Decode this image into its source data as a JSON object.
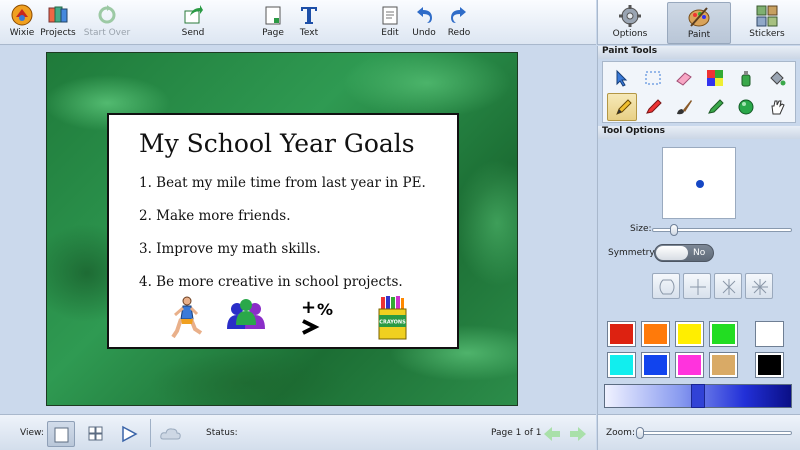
{
  "toolbar": {
    "wixie": "Wixie",
    "projects": "Projects",
    "start_over": "Start Over",
    "send": "Send",
    "page": "Page",
    "text": "Text",
    "edit": "Edit",
    "undo": "Undo",
    "redo": "Redo"
  },
  "right_tabs": {
    "options": "Options",
    "paint": "Paint",
    "stickers": "Stickers",
    "active": "Paint"
  },
  "document": {
    "title": "My School Year Goals",
    "goals": [
      "1. Beat my mile time from last year in PE.",
      "2. Make more friends.",
      "3. Improve my math skills.",
      "4. Be more creative in school projects."
    ],
    "clipart": [
      "runner-icon",
      "people-group-icon",
      "math-symbols-icon",
      "crayons-box-icon"
    ],
    "crayon_box_text": "CRAYONS"
  },
  "bottom": {
    "view_label": "View:",
    "status_label": "Status:",
    "page_indicator": "Page 1 of 1",
    "zoom_label": "Zoom:"
  },
  "panel": {
    "paint_tools_header": "Paint Tools",
    "tool_options_header": "Tool Options",
    "tools": [
      "select-arrow-icon",
      "marquee-select-icon",
      "eraser-icon",
      "color-picker-icon",
      "spray-can-icon",
      "paint-bucket-icon",
      "pencil-icon",
      "marker-icon",
      "paintbrush-icon",
      "highlighter-icon",
      "ball-stamp-icon",
      "grab-hand-icon"
    ],
    "active_tool": "pencil-icon",
    "size_label": "Size:",
    "size_value": 0.05,
    "symmetry_label": "Symmetry:",
    "symmetry_value": "No",
    "symmetry_modes": [
      "no-symmetry-icon",
      "vertical-horizontal-symmetry-icon",
      "four-way-symmetry-icon",
      "radial-symmetry-icon"
    ],
    "colors": [
      "#dd2211",
      "#ff7a0a",
      "#ffee00",
      "#22dd22",
      "#ffffff",
      "#11eeee",
      "#1144ee",
      "#ff33dd",
      "#d9aa66",
      "#000000"
    ],
    "selected_color": "#1547c4",
    "zoom_value": 0.0
  }
}
